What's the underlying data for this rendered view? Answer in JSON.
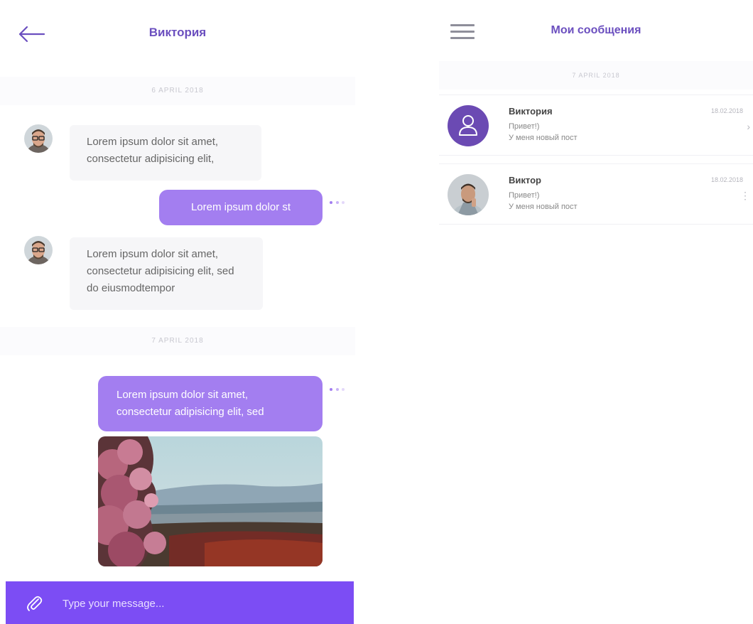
{
  "chat": {
    "title": "Виктория",
    "dates": [
      "6 APRIL 2018",
      "7 APRIL 2018"
    ],
    "messages": {
      "in1": "Lorem ipsum dolor sit amet, consectetur adipisicing elit,",
      "out1": "Lorem ipsum dolor st",
      "in2": "Lorem ipsum dolor sit amet, consectetur adipisicing elit, sed do eiusmodtempor",
      "out2": "Lorem ipsum dolor sit amet, consectetur adipisicing elit, sed"
    },
    "composer_placeholder": "Type your message..."
  },
  "list": {
    "title": "Мои сообщения",
    "date": "7 APRIL 2018",
    "conversations": [
      {
        "name": "Виктория",
        "preview1": "Привет!)",
        "preview2": "У меня новый пост",
        "time": "18.02.2018"
      },
      {
        "name": "Виктор",
        "preview1": "Привет!)",
        "preview2": "У меня новый пост",
        "time": "18.02.2018"
      }
    ]
  },
  "colors": {
    "accent": "#7c4df4",
    "bubble_out": "#a37ef0",
    "title": "#6b4fbf"
  },
  "icons": [
    "back-arrow-icon",
    "menu-icon",
    "attachment-icon",
    "user-icon",
    "more-icon",
    "chevron-right-icon"
  ]
}
